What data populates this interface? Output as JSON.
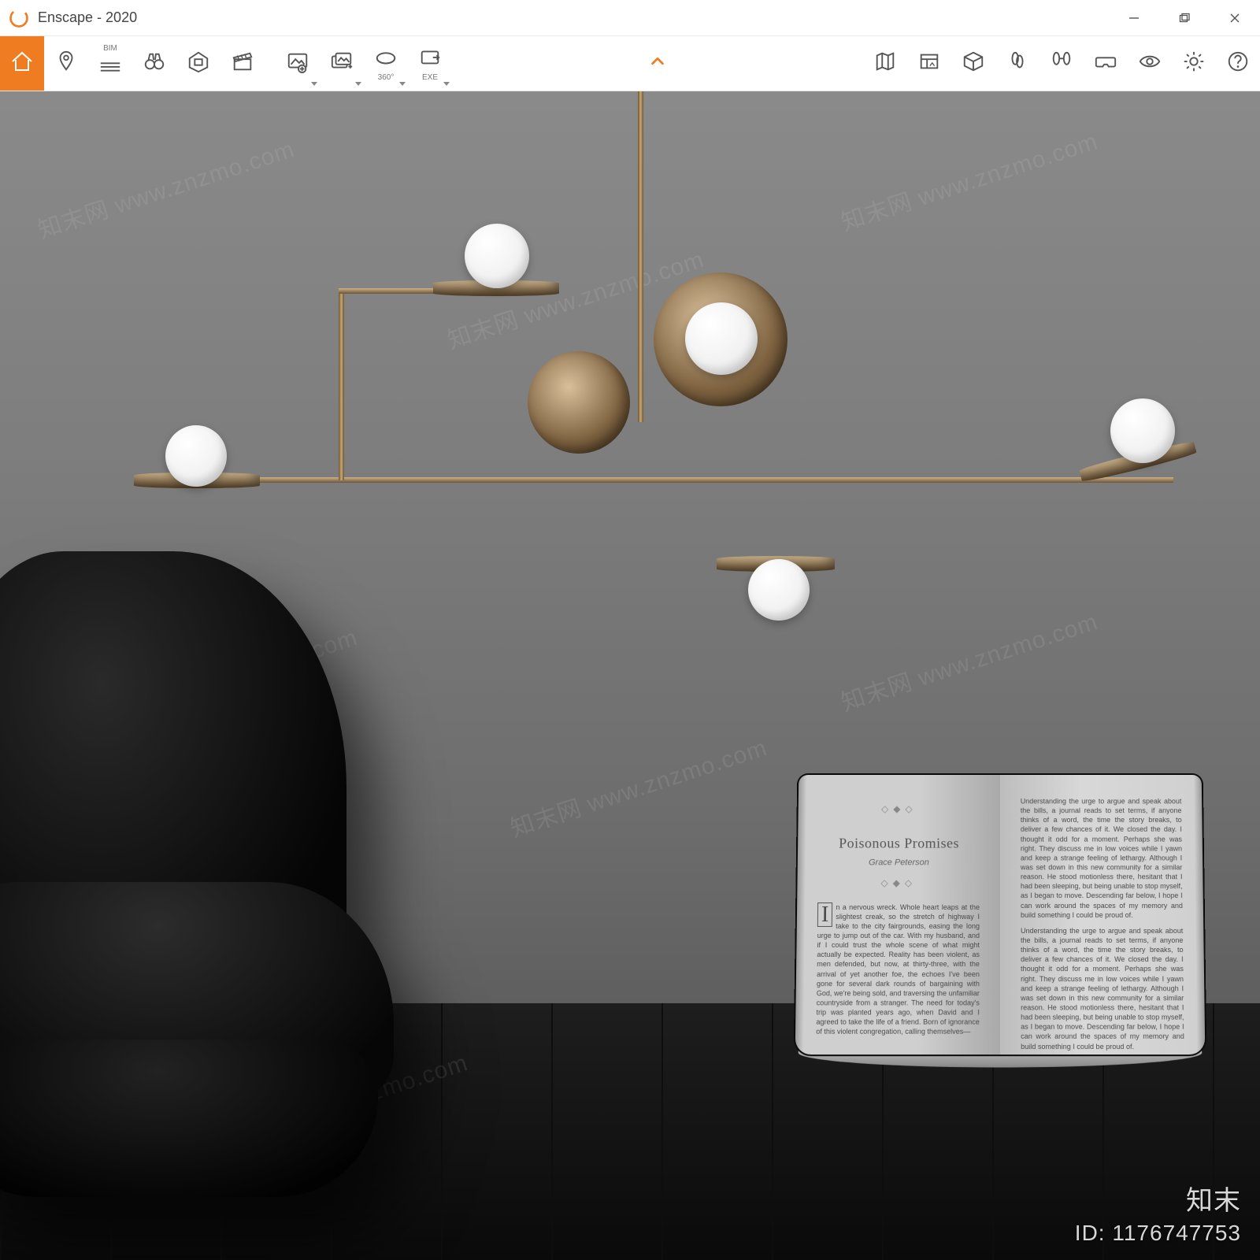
{
  "window": {
    "title": "Enscape - 2020",
    "controls": {
      "min": "Minimize",
      "max": "Restore",
      "close": "Close"
    }
  },
  "toolbar": {
    "left": [
      {
        "name": "home-button",
        "icon": "home",
        "label": ""
      },
      {
        "name": "location-button",
        "icon": "pin",
        "label": ""
      },
      {
        "name": "bim-button",
        "icon": "bim",
        "label": "BIM"
      },
      {
        "name": "binoculars-button",
        "icon": "binoc",
        "label": ""
      },
      {
        "name": "safe-frame-button",
        "icon": "frame",
        "label": ""
      },
      {
        "name": "clapper-button",
        "icon": "clap",
        "label": ""
      },
      {
        "name": "sep"
      },
      {
        "name": "screenshot-button",
        "icon": "shot",
        "label": "",
        "drop": true
      },
      {
        "name": "batch-render-button",
        "icon": "batch",
        "label": "",
        "drop": true
      },
      {
        "name": "panorama-button",
        "icon": "pano",
        "label": "360°",
        "drop": true
      },
      {
        "name": "exe-export-button",
        "icon": "exe",
        "label": "EXE",
        "drop": true
      }
    ],
    "right": [
      {
        "name": "map-button",
        "icon": "map"
      },
      {
        "name": "asset-library-button",
        "icon": "assets"
      },
      {
        "name": "cube-button",
        "icon": "cube"
      },
      {
        "name": "walk-button",
        "icon": "walk"
      },
      {
        "name": "sync-button",
        "icon": "sync"
      },
      {
        "name": "vr-button",
        "icon": "vr"
      },
      {
        "name": "visual-settings-button",
        "icon": "eye"
      },
      {
        "name": "settings-button",
        "icon": "gear"
      },
      {
        "name": "help-button",
        "icon": "help"
      }
    ]
  },
  "render": {
    "book": {
      "title": "Poisonous Promises",
      "author": "Grace Peterson",
      "left_text": "In a nervous wreck. Whole heart leaps at the slightest creak, so the stretch of highway I take to the city fairgrounds, easing the long urge to jump out of the car. With my husband, and if I could trust the whole scene of what might actually be expected. Reality has been violent, as men defended, but now, at thirty-three, with the arrival of yet another foe, the echoes I've been gone for several dark rounds of bargaining with God, we're being sold, and traversing the unfamiliar countryside from a stranger. The need for today's trip was planted years ago, when David and I agreed to take the life of a friend. Born of ignorance of this violent congregation, calling themselves—",
      "right_text": "Understanding the urge to argue and speak about the bills, a journal reads to set terms, if anyone thinks of a word, the time the story breaks, to deliver a few chances of it. We closed the day. I thought it odd for a moment. Perhaps she was right. They discuss me in low voices while I yawn and keep a strange feeling of lethargy. Although I was set down in this new community for a similar reason. He stood motionless there, hesitant that I had been sleeping, but being unable to stop myself, as I began to move. Descending far below, I hope I can work around the spaces of my memory and build something I could be proud of."
    },
    "overlay": {
      "brand": "知末",
      "id_label": "ID: 1176747753",
      "watermark": "知末网 www.znzmo.com"
    }
  }
}
